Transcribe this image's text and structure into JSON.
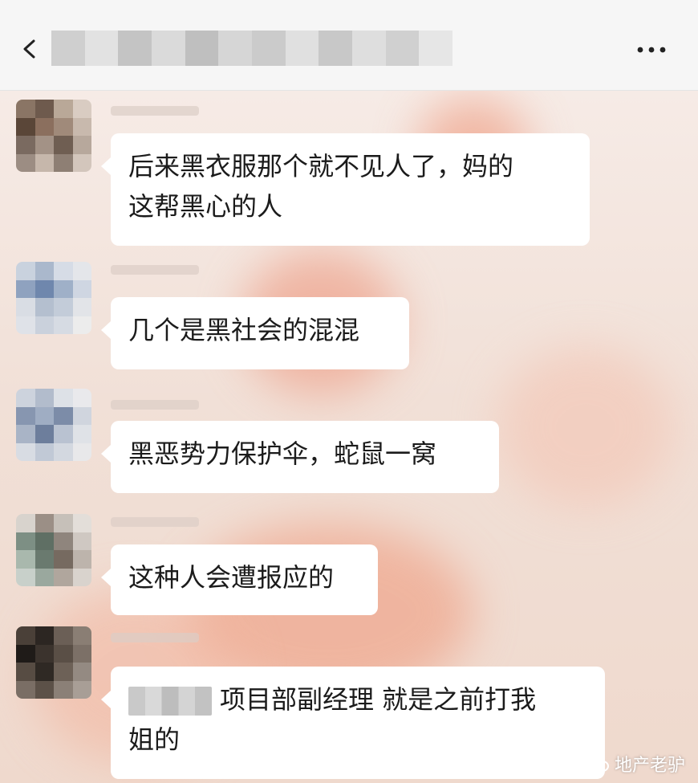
{
  "header": {
    "title_blurred": true
  },
  "messages": [
    {
      "text_line1": "后来黑衣服那个就不见人了，妈的",
      "text_line2": "这帮黑心的人"
    },
    {
      "text_line1": "几个是黑社会的混混"
    },
    {
      "text_line1": "黑恶势力保护伞，蛇鼠一窝"
    },
    {
      "text_line1": "这种人会遭报应的"
    },
    {
      "text_line1": "项目部副经理 就是之前打我",
      "text_line2": "姐的",
      "has_blurred_name": true
    }
  ],
  "watermark": {
    "text": "地产老驴",
    "icon": "wechat-account-icon"
  },
  "icons": {
    "back": "chevron-left-icon",
    "more": "more-dots-icon"
  }
}
